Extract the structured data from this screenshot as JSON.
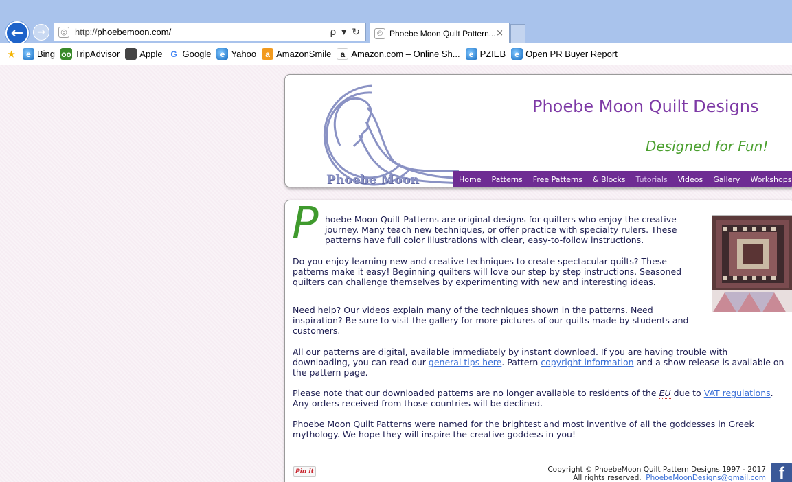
{
  "browser": {
    "address_url_prefix": "http://",
    "address_url_domain": "phoebemoon.com/",
    "search_glyph": "ρ",
    "dropdown_glyph": "▾",
    "refresh_glyph": "↻",
    "back_glyph": "←",
    "forward_glyph": "→",
    "tab_title": "Phoebe Moon Quilt Pattern...",
    "tab_close": "×",
    "favorites": [
      {
        "label": "Bing",
        "icon": "ie-icon"
      },
      {
        "label": "TripAdvisor",
        "icon": "tripadvisor-icon"
      },
      {
        "label": "Apple",
        "icon": "apple-icon"
      },
      {
        "label": "Google",
        "icon": "google-icon"
      },
      {
        "label": "Yahoo",
        "icon": "ie-icon"
      },
      {
        "label": "AmazonSmile",
        "icon": "amazon-icon"
      },
      {
        "label": "Amazon.com – Online Sh...",
        "icon": "amazon-icon"
      },
      {
        "label": "PZIEB",
        "icon": "ie-icon"
      },
      {
        "label": "Open PR Buyer Report",
        "icon": "ie-icon"
      }
    ]
  },
  "header": {
    "logo_text": "Phoebe Moon",
    "title": "Phoebe Moon Quilt Designs",
    "tagline": "Designed for Fun!",
    "nav": [
      "Home",
      "Patterns",
      "Free Patterns",
      "& Blocks",
      "Tutorials",
      "Videos",
      "Gallery",
      "Workshops"
    ]
  },
  "content": {
    "dropcap": "P",
    "p1": "hoebe Moon Quilt Patterns are original designs for quilters who enjoy the creative journey. Many teach new techniques, or offer practice with specialty rulers. These patterns have full color illustrations with clear, easy-to-follow instructions.",
    "p2": "Do you enjoy learning new and creative techniques to create spectacular quilts? These patterns make it easy! Beginning quilters will love our step by step instructions. Seasoned quilters can challenge themselves by experimenting with new and interesting ideas.",
    "p3": "Need help? Our videos explain many of the techniques shown in the patterns. Need inspiration? Be sure to visit the gallery for more pictures of our quilts made by students and customers.",
    "p4_a": "All our patterns are digital, available immediately by instant download.  If you are having trouble with downloading, you can read our ",
    "p4_link1": "general tips here",
    "p4_b": ".  Pattern ",
    "p4_link2": "copyright information",
    "p4_c": " and a show release is available on the pattern page.",
    "p5_a": "Please note that our downloaded patterns are no longer available to residents of the ",
    "p5_eu": "EU",
    "p5_b": " due to ",
    "p5_link": "VAT regulations",
    "p5_c": ". Any orders received from those countries will be declined.",
    "p6": "Phoebe Moon Quilt Patterns were named for the brightest and most inventive of all the goddesses in Greek mythology. We hope they will inspire the creative goddess in you!",
    "pinit": "Pin it",
    "copyright_line1": "Copyright © PhoebeMoon Quilt Pattern Designs 1997 - 2017",
    "copyright_line2": "All rights reserved.",
    "email": "PhoebeMoonDesigns@gmail.com",
    "facebook_glyph": "f"
  }
}
